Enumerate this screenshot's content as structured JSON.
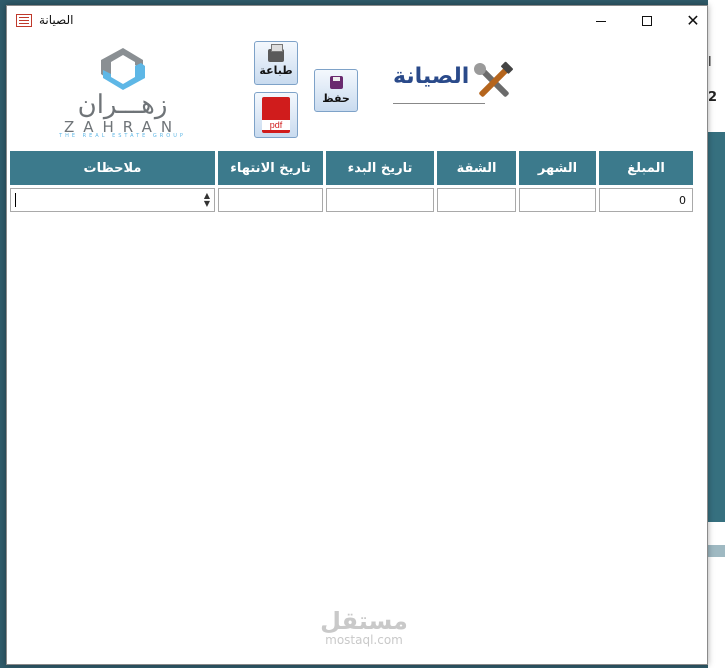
{
  "window": {
    "title": "الصيانة",
    "minimize_label": "",
    "maximize_label": "",
    "close_label": "✕"
  },
  "background": {
    "frag_top": "ا",
    "frag_mid": "2"
  },
  "logo": {
    "arabic": "زهـــران",
    "latin": "ZAHRAN",
    "tagline": "THE REAL ESTATE GROUP"
  },
  "toolbar": {
    "print_label": "طباعة",
    "save_label": "حفظ",
    "pdf_label": "pdf"
  },
  "form": {
    "title": "الصيانة"
  },
  "table": {
    "headers": {
      "amount": "المبلغ",
      "month": "الشهر",
      "apartment": "الشقة",
      "start_date": "تاريخ البدء",
      "end_date": "تاريخ الانتهاء",
      "notes": "ملاحظات"
    },
    "row": {
      "amount": "0",
      "month": "",
      "apartment": "",
      "start_date": "",
      "end_date": "",
      "notes": ""
    }
  },
  "watermark": {
    "arabic": "مستقل",
    "latin": "mostaql.com"
  },
  "colors": {
    "header_bg": "#3c7a8c",
    "title": "#2a4a8a",
    "backdrop": "#2f5b6a"
  }
}
